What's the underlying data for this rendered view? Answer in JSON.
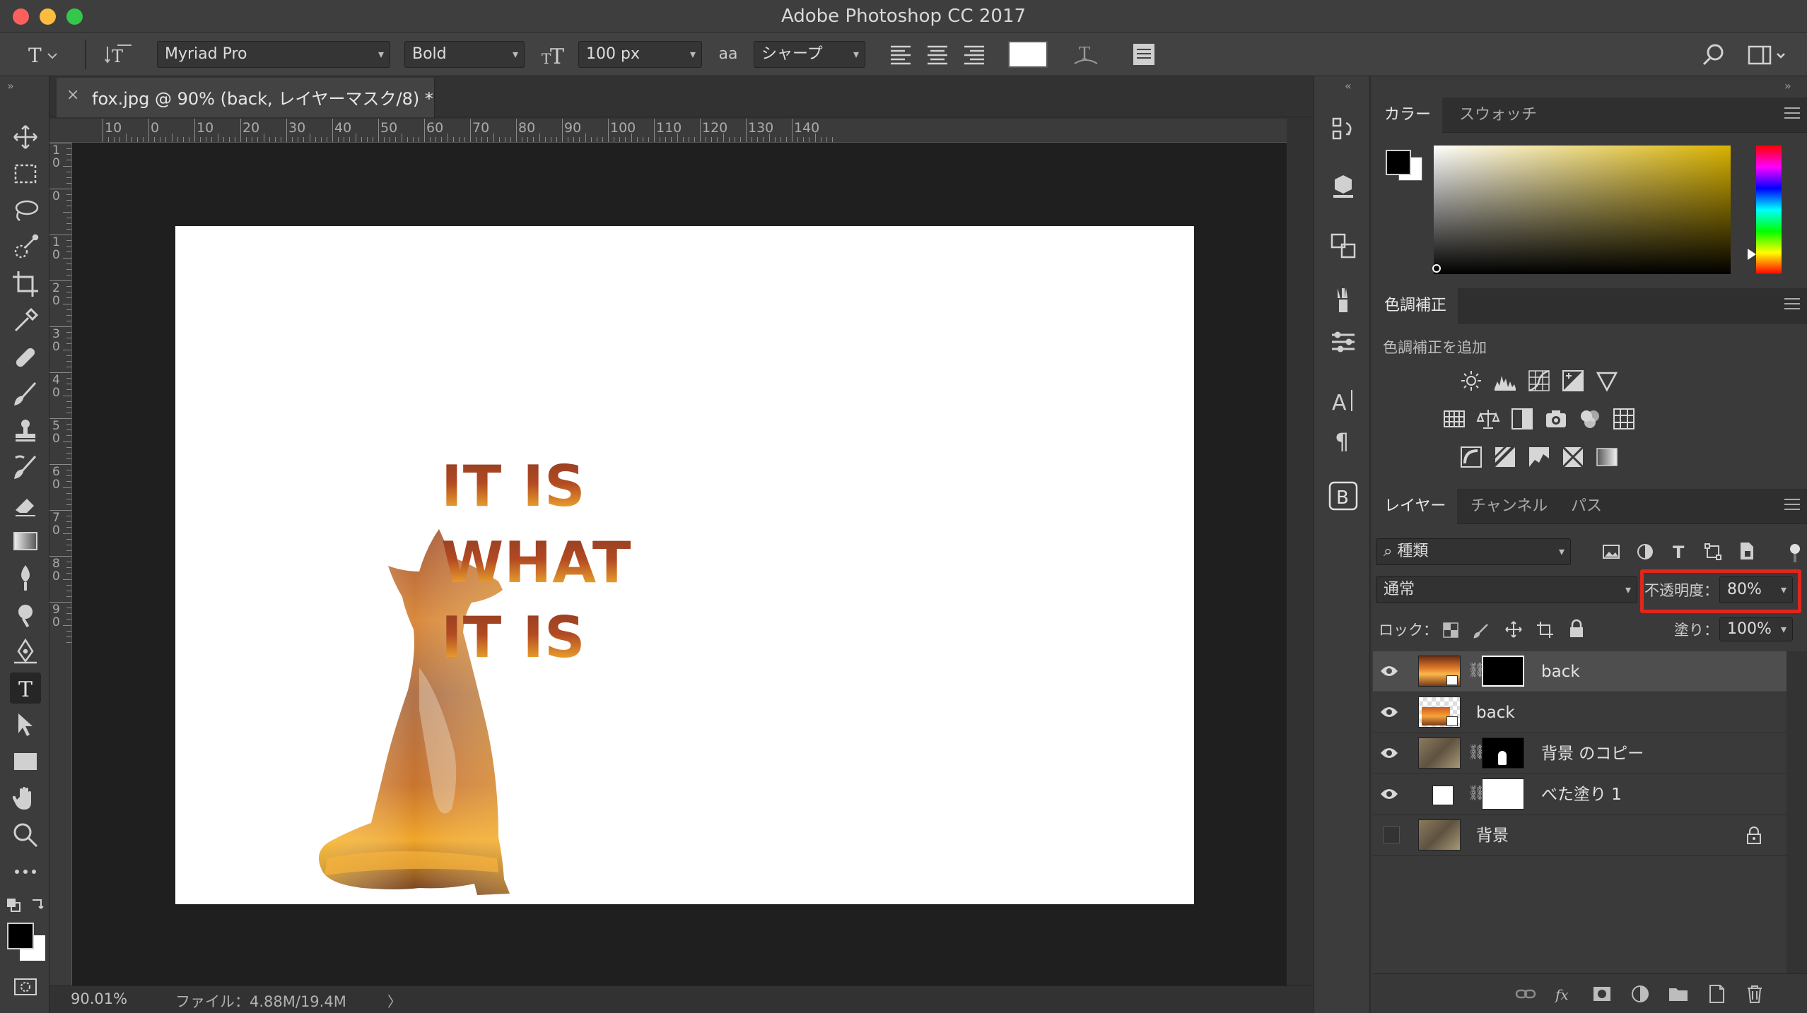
{
  "window": {
    "title": "Adobe Photoshop CC 2017"
  },
  "options_bar": {
    "font_family": "Myriad Pro",
    "font_style": "Bold",
    "font_size": "100 px",
    "antialias_icon": "aa",
    "antialias": "シャープ",
    "text_color": "#ffffff"
  },
  "document": {
    "tab_label": "fox.jpg @ 90% (back, レイヤーマスク/8) *",
    "close_glyph": "×",
    "headline": [
      "IT IS",
      "WHAT",
      "IT IS"
    ]
  },
  "rulers": {
    "horizontal": [
      "10",
      "0",
      "10",
      "20",
      "30",
      "40",
      "50",
      "60",
      "70",
      "80",
      "90",
      "100",
      "110",
      "120",
      "130",
      "140"
    ],
    "vertical": [
      "10",
      "0",
      "10",
      "20",
      "30",
      "40",
      "50",
      "60",
      "70",
      "80",
      "90"
    ]
  },
  "status_bar": {
    "zoom": "90.01%",
    "file_info": "ファイル：4.88M/19.4M",
    "arrow": "〉"
  },
  "color_panel": {
    "tabs": [
      "カラー",
      "スウォッチ"
    ],
    "foreground": "#000000",
    "background": "#ffffff",
    "hue_color": "#d9b200"
  },
  "adjustments_panel": {
    "tab": "色調補正",
    "add_label": "色調補正を追加",
    "icons": [
      [
        "brightness-icon",
        "levels-icon",
        "curves-icon",
        "exposure-icon",
        "vibrance-icon"
      ],
      [
        "hue-saturation-icon",
        "color-balance-icon",
        "black-white-icon",
        "photo-filter-icon",
        "channel-mixer-icon",
        "color-lookup-icon"
      ],
      [
        "invert-icon",
        "posterize-icon",
        "threshold-icon",
        "selective-color-icon",
        "gradient-map-icon"
      ]
    ]
  },
  "layers_panel": {
    "tabs": [
      "レイヤー",
      "チャンネル",
      "パス"
    ],
    "filter_kind": "種類",
    "blend_mode": "通常",
    "opacity_label": "不透明度：",
    "opacity_value": "80%",
    "opacity_value_fraction": 0.8,
    "lock_label": "ロック：",
    "fill_label": "塗り：",
    "fill_value": "100%",
    "highlight_color": "#e0261d",
    "layers": [
      {
        "name": "back",
        "selected": true,
        "visible": true,
        "has_mask": true
      },
      {
        "name": "back",
        "selected": false,
        "visible": true,
        "has_mask": false
      },
      {
        "name": "背景 のコピー",
        "selected": false,
        "visible": true,
        "has_mask": true
      },
      {
        "name": "べた塗り 1",
        "selected": false,
        "visible": true,
        "has_mask": true
      },
      {
        "name": "背景",
        "selected": false,
        "visible": false,
        "has_mask": false,
        "locked": true
      }
    ]
  }
}
